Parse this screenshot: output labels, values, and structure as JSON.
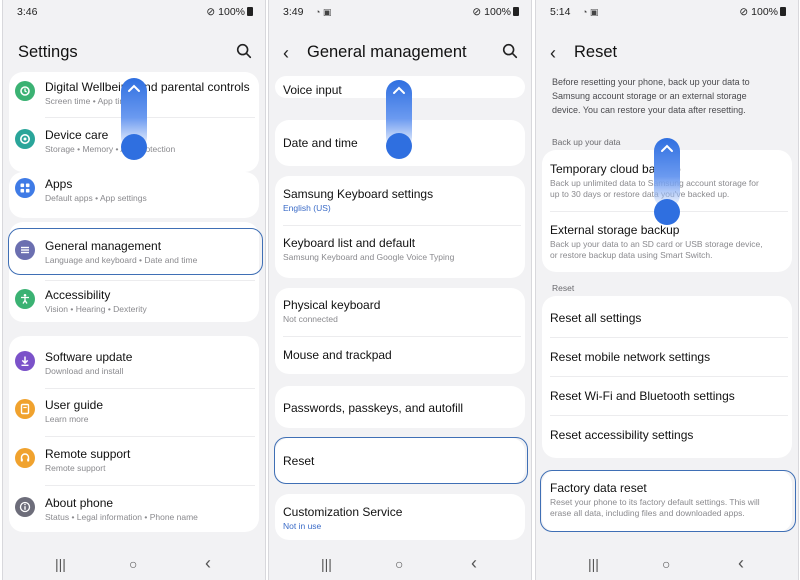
{
  "panel1": {
    "status": {
      "time": "3:46",
      "battery": "100%"
    },
    "title": "Settings",
    "items": [
      {
        "title": "Digital Wellbeing and parental controls",
        "subtitle": "Screen time  •  App timers",
        "icon": "wellbeing-icon",
        "color": "#3bb273"
      },
      {
        "title": "Device care",
        "subtitle": "Storage  •  Memory  •  App protection",
        "icon": "device-care-icon",
        "color": "#2aa59a"
      },
      {
        "title": "Apps",
        "subtitle": "Default apps  •  App settings",
        "icon": "apps-icon",
        "color": "#3f7be6"
      },
      {
        "title": "General management",
        "subtitle": "Language and keyboard  •  Date and time",
        "icon": "general-management-icon",
        "color": "#6b6fb0"
      },
      {
        "title": "Accessibility",
        "subtitle": "Vision  •  Hearing  •  Dexterity",
        "icon": "accessibility-icon",
        "color": "#3bb273"
      },
      {
        "title": "Software update",
        "subtitle": "Download and install",
        "icon": "software-update-icon",
        "color": "#7b52c9"
      },
      {
        "title": "User guide",
        "subtitle": "Learn more",
        "icon": "user-guide-icon",
        "color": "#f0a22e"
      },
      {
        "title": "Remote support",
        "subtitle": "Remote support",
        "icon": "remote-support-icon",
        "color": "#f0a22e"
      },
      {
        "title": "About phone",
        "subtitle": "Status  •  Legal information  •  Phone name",
        "icon": "about-phone-icon",
        "color": "#6d6d7a"
      }
    ]
  },
  "panel2": {
    "status": {
      "time": "3:49",
      "battery": "100%"
    },
    "title": "General management",
    "items": [
      {
        "title": "Voice input",
        "subtitle": ""
      },
      {
        "title": "Date and time",
        "subtitle": ""
      },
      {
        "title": "Samsung Keyboard settings",
        "subtitle": "English (US)"
      },
      {
        "title": "Keyboard list and default",
        "subtitle": "Samsung Keyboard and Google Voice Typing"
      },
      {
        "title": "Physical keyboard",
        "subtitle": "Not connected"
      },
      {
        "title": "Mouse and trackpad",
        "subtitle": ""
      },
      {
        "title": "Passwords, passkeys, and autofill",
        "subtitle": ""
      },
      {
        "title": "Reset",
        "subtitle": ""
      },
      {
        "title": "Customization Service",
        "subtitle": "Not in use"
      }
    ]
  },
  "panel3": {
    "status": {
      "time": "5:14",
      "battery": "100%"
    },
    "title": "Reset",
    "intro": [
      "Before resetting your phone, back up your data to",
      "Samsung account storage or an external storage",
      "device. You can restore your data after resetting."
    ],
    "backup_section": "Back up your data",
    "backup_items": [
      {
        "title": "Temporary cloud backup",
        "subtitle": [
          "Back up unlimited data to Samsung account storage for",
          "up to 30 days or restore data you've backed up."
        ]
      },
      {
        "title": "External storage backup",
        "subtitle": [
          "Back up your data to an SD card or USB storage device,",
          "or restore backup data using Smart Switch."
        ]
      }
    ],
    "reset_section": "Reset",
    "reset_items": [
      {
        "title": "Reset all settings"
      },
      {
        "title": "Reset mobile network settings"
      },
      {
        "title": "Reset Wi-Fi and Bluetooth settings"
      },
      {
        "title": "Reset accessibility settings"
      }
    ],
    "factory": {
      "title": "Factory data reset",
      "subtitle": [
        "Reset your phone to its factory default settings. This will",
        "erase all data, including files and downloaded apps."
      ]
    }
  },
  "nav": {
    "recents": "|||",
    "home": "○",
    "back": "‹"
  },
  "accent": "#3f6fb5",
  "gesture_color": "#2f6fe0"
}
